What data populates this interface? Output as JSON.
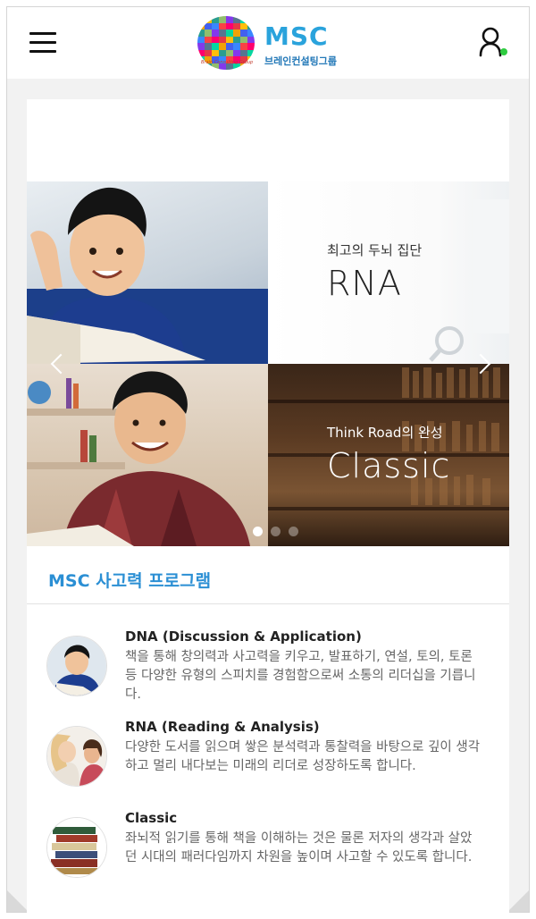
{
  "header": {
    "brand_name": "MSC",
    "brand_korean": "브레인컨설팅그룹",
    "brand_tagline": "Brain Consulting Group",
    "menu_icon": "hamburger-menu-icon",
    "user_icon": "user-profile-icon",
    "online_color": "#2ecc40"
  },
  "slider": {
    "slides": [
      {
        "subtitle": "최고의 두뇌 집단",
        "title": "RNA"
      },
      {
        "subtitle": "Think Road의 완성",
        "title": "Classic"
      }
    ],
    "dots": 3,
    "active_dot": 1
  },
  "section": {
    "title": "MSC 사고력 프로그램",
    "accent_color": "#2b8fd4"
  },
  "programs": [
    {
      "title": "DNA (Discussion & Application)",
      "desc": "책을 통해 창의력과 사고력을 키우고, 발표하기, 연설, 토의, 토론 등 다양한 유형의 스피치를 경험함으로써 소통의 리더십을 기릅니다."
    },
    {
      "title": "RNA (Reading & Analysis)",
      "desc": "다양한 도서를 읽으며 쌓은 분석력과 통찰력을 바탕으로 깊이 생각하고 멀리 내다보는 미래의 리더로 성장하도록 합니다."
    },
    {
      "title": "Classic",
      "desc": "좌뇌적 읽기를 통해 책을 이해하는 것은 물론 저자의 생각과 살았던 시대의 패러다임까지 차원을 높이며 사고할 수 있도록 합니다."
    }
  ]
}
